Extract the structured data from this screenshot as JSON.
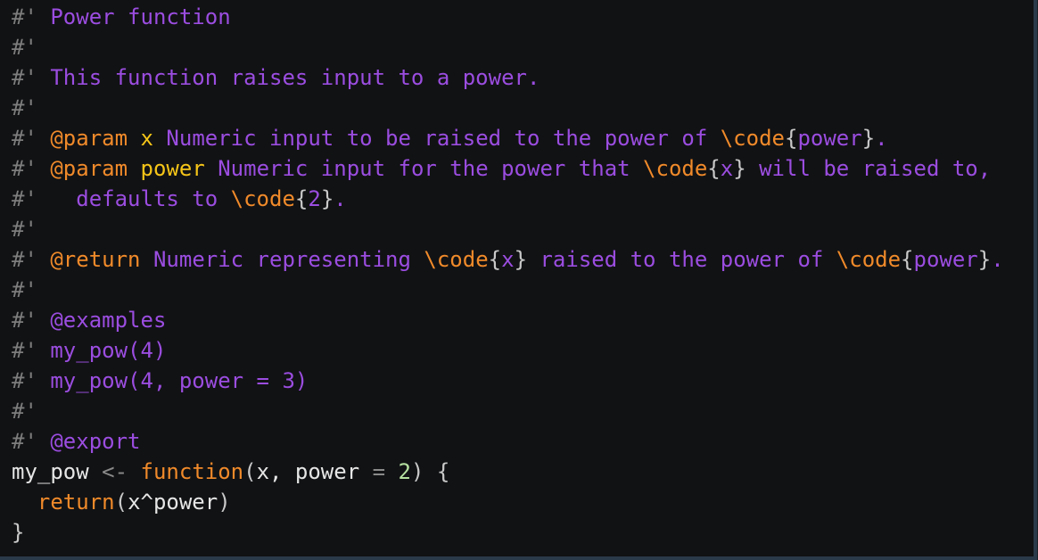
{
  "editor": {
    "colors": {
      "background": "#111214",
      "comment": "#9b4de0",
      "hash": "#7d7d7d",
      "roxygen_tag": "#f08a2a",
      "param_name": "#f5c518",
      "keyword": "#f08a2a",
      "identifier": "#e6e6e6",
      "operator": "#8a8a8a",
      "number": "#b5e0a0"
    },
    "lines": [
      [
        {
          "type": "hash",
          "text": "#'"
        },
        {
          "type": "comment",
          "text": " Power function"
        }
      ],
      [
        {
          "type": "hash",
          "text": "#'"
        }
      ],
      [
        {
          "type": "hash",
          "text": "#'"
        },
        {
          "type": "comment",
          "text": " This function raises input to a power."
        }
      ],
      [
        {
          "type": "hash",
          "text": "#'"
        }
      ],
      [
        {
          "type": "hash",
          "text": "#'"
        },
        {
          "type": "comment",
          "text": " "
        },
        {
          "type": "tag",
          "text": "@param"
        },
        {
          "type": "comment",
          "text": " "
        },
        {
          "type": "param",
          "text": "x"
        },
        {
          "type": "comment",
          "text": " Numeric input to be raised to the power of "
        },
        {
          "type": "cmd",
          "text": "\\code"
        },
        {
          "type": "brace",
          "text": "{"
        },
        {
          "type": "comment",
          "text": "power"
        },
        {
          "type": "brace",
          "text": "}"
        },
        {
          "type": "comment",
          "text": "."
        }
      ],
      [
        {
          "type": "hash",
          "text": "#'"
        },
        {
          "type": "comment",
          "text": " "
        },
        {
          "type": "tag",
          "text": "@param"
        },
        {
          "type": "comment",
          "text": " "
        },
        {
          "type": "param",
          "text": "power"
        },
        {
          "type": "comment",
          "text": " Numeric input for the power that "
        },
        {
          "type": "cmd",
          "text": "\\code"
        },
        {
          "type": "brace",
          "text": "{"
        },
        {
          "type": "comment",
          "text": "x"
        },
        {
          "type": "brace",
          "text": "}"
        },
        {
          "type": "comment",
          "text": " will be raised to,"
        }
      ],
      [
        {
          "type": "hash",
          "text": "#'"
        },
        {
          "type": "comment",
          "text": "   defaults to "
        },
        {
          "type": "cmd",
          "text": "\\code"
        },
        {
          "type": "brace",
          "text": "{"
        },
        {
          "type": "comment",
          "text": "2"
        },
        {
          "type": "brace",
          "text": "}"
        },
        {
          "type": "comment",
          "text": "."
        }
      ],
      [
        {
          "type": "hash",
          "text": "#'"
        }
      ],
      [
        {
          "type": "hash",
          "text": "#'"
        },
        {
          "type": "comment",
          "text": " "
        },
        {
          "type": "tag",
          "text": "@return"
        },
        {
          "type": "comment",
          "text": " Numeric representing "
        },
        {
          "type": "cmd",
          "text": "\\code"
        },
        {
          "type": "brace",
          "text": "{"
        },
        {
          "type": "comment",
          "text": "x"
        },
        {
          "type": "brace",
          "text": "}"
        },
        {
          "type": "comment",
          "text": " raised to the power of "
        },
        {
          "type": "cmd",
          "text": "\\code"
        },
        {
          "type": "brace",
          "text": "{"
        },
        {
          "type": "comment",
          "text": "power"
        },
        {
          "type": "brace",
          "text": "}"
        },
        {
          "type": "comment",
          "text": "."
        }
      ],
      [
        {
          "type": "hash",
          "text": "#'"
        }
      ],
      [
        {
          "type": "hash",
          "text": "#'"
        },
        {
          "type": "comment",
          "text": " "
        },
        {
          "type": "comment",
          "text": "@examples"
        }
      ],
      [
        {
          "type": "hash",
          "text": "#'"
        },
        {
          "type": "comment",
          "text": " my_pow(4)"
        }
      ],
      [
        {
          "type": "hash",
          "text": "#'"
        },
        {
          "type": "comment",
          "text": " my_pow(4, power = 3)"
        }
      ],
      [
        {
          "type": "hash",
          "text": "#'"
        }
      ],
      [
        {
          "type": "hash",
          "text": "#'"
        },
        {
          "type": "comment",
          "text": " "
        },
        {
          "type": "comment",
          "text": "@export"
        }
      ],
      [
        {
          "type": "ident",
          "text": "my_pow "
        },
        {
          "type": "op",
          "text": "<-"
        },
        {
          "type": "ident",
          "text": " "
        },
        {
          "type": "kw",
          "text": "function"
        },
        {
          "type": "punc",
          "text": "("
        },
        {
          "type": "ident",
          "text": "x, power "
        },
        {
          "type": "op",
          "text": "="
        },
        {
          "type": "ident",
          "text": " "
        },
        {
          "type": "num",
          "text": "2"
        },
        {
          "type": "punc",
          "text": ") {"
        }
      ],
      [
        {
          "type": "ident",
          "text": "  "
        },
        {
          "type": "kw",
          "text": "return"
        },
        {
          "type": "punc",
          "text": "("
        },
        {
          "type": "ident",
          "text": "x^power"
        },
        {
          "type": "punc",
          "text": ")"
        }
      ],
      [
        {
          "type": "punc",
          "text": "}"
        }
      ]
    ]
  }
}
